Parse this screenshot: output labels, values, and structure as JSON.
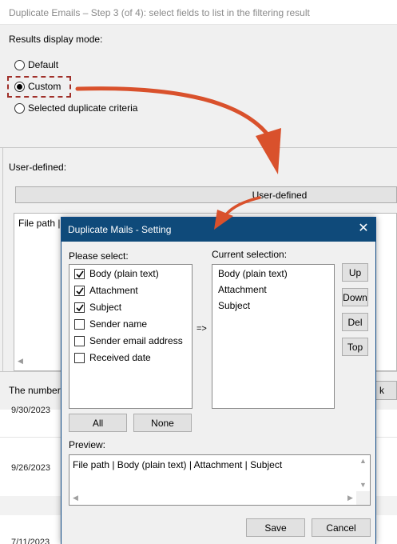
{
  "background_window": {
    "title": "Duplicate Emails – Step 3 (of 4): select fields to list in the filtering result",
    "results_display_mode_label": "Results display mode:",
    "radio_options": [
      {
        "label": "Default",
        "checked": false
      },
      {
        "label": "Custom",
        "checked": true
      },
      {
        "label": "Selected duplicate criteria",
        "checked": false
      }
    ],
    "user_defined_label": "User-defined:",
    "user_defined_header": "User-defined",
    "list_text": "File path |",
    "status_text": "The number",
    "right_button_label": "k",
    "email_dates": [
      "9/30/2023",
      "9/26/2023",
      "7/11/2023"
    ]
  },
  "modal": {
    "title": "Duplicate Mails - Setting",
    "close_glyph": "✕",
    "please_select_label": "Please select:",
    "current_selection_label": "Current selection:",
    "fields": [
      {
        "label": "Body (plain text)",
        "checked": true
      },
      {
        "label": "Attachment",
        "checked": true
      },
      {
        "label": "Subject",
        "checked": true
      },
      {
        "label": "Sender name",
        "checked": false
      },
      {
        "label": "Sender email address",
        "checked": false
      },
      {
        "label": "Received date",
        "checked": false
      }
    ],
    "arrow_text": "=>",
    "current_selection": [
      "Body (plain text)",
      "Attachment",
      "Subject"
    ],
    "buttons": {
      "up": "Up",
      "down": "Down",
      "del": "Del",
      "top": "Top",
      "all": "All",
      "none": "None",
      "save": "Save",
      "cancel": "Cancel"
    },
    "preview_label": "Preview:",
    "preview_text": "File path | Body (plain text) | Attachment | Subject"
  },
  "colors": {
    "modal_titlebar": "#0f4a7a",
    "annotation_arrow": "#d9512c",
    "highlight_dash": "#a0302a"
  },
  "icons": [
    "close-icon",
    "check-icon",
    "radio-selected-icon",
    "scroll-up-icon",
    "scroll-down-icon",
    "scroll-left-icon",
    "scroll-right-icon",
    "annotation-arrow-icon"
  ]
}
